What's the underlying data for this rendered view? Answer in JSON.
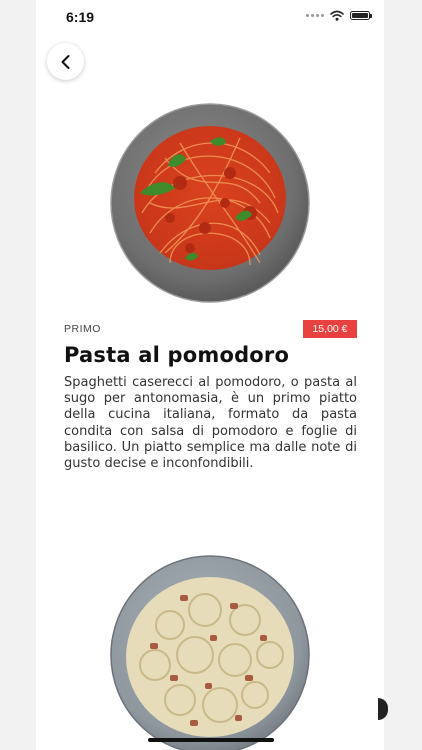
{
  "status_bar": {
    "time": "6:19"
  },
  "icons": {
    "back": "chevron-left-icon",
    "wifi": "wifi-icon",
    "battery": "battery-icon",
    "signal": "signal-icon"
  },
  "dishes": [
    {
      "category": "PRIMO",
      "price": "15,00 €",
      "title": "Pasta al pomodoro",
      "description": "Spaghetti caserecci al pomodoro, o pasta al sugo per antonomasia, è un primo piatto della cucina italiana, formato da pasta condita con salsa di pomodoro e foglie di basilico. Un piatto semplice ma dalle note di gusto decise e inconfondibili.",
      "image": "spaghetti-tomato-photo"
    },
    {
      "image": "pasta-carbonara-photo"
    }
  ],
  "colors": {
    "price_badge": "#e94040",
    "background": "#f2f2f3",
    "card": "#ffffff",
    "text": "#111111"
  }
}
